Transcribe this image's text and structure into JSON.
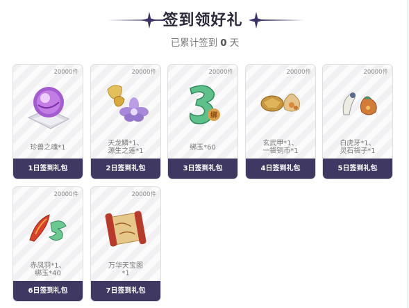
{
  "header": {
    "title": "签到领好礼",
    "subtitle_prefix": "已累计签到",
    "signed_days": "0",
    "subtitle_suffix": "天"
  },
  "colors": {
    "button_bg": "#3f3862",
    "title_text": "#2e2a3c",
    "deco_line": "#3c3168"
  },
  "cards": [
    {
      "count": "20000件",
      "item": "珍兽之魂*1",
      "button": "1日签到礼包",
      "icon": "purple-orb-icon"
    },
    {
      "count": "20000件",
      "item": "天龙鳞*1、\n源生之莲*1",
      "button": "2日签到礼包",
      "icon": "dragon-scale-lotus-icon"
    },
    {
      "count": "20000件",
      "item": "绑玉*60",
      "button": "3日签到礼包",
      "icon": "jade-bound-icon"
    },
    {
      "count": "20000件",
      "item": "玄武甲*1、\n一袋铜币*1",
      "button": "4日签到礼包",
      "icon": "turtle-armor-coin-bag-icon"
    },
    {
      "count": "20000件",
      "item": "白虎牙*1、\n灵石袋子*1",
      "button": "5日签到礼包",
      "icon": "tiger-fang-stone-bag-icon"
    },
    {
      "count": "20000件",
      "item": "赤凤羽*1、\n绑玉*40",
      "button": "6日签到礼包",
      "icon": "phoenix-feather-jade-icon"
    },
    {
      "count": "20000件",
      "item": "万华天宝图\n*1",
      "button": "7日签到礼包",
      "icon": "treasure-scroll-icon"
    }
  ]
}
